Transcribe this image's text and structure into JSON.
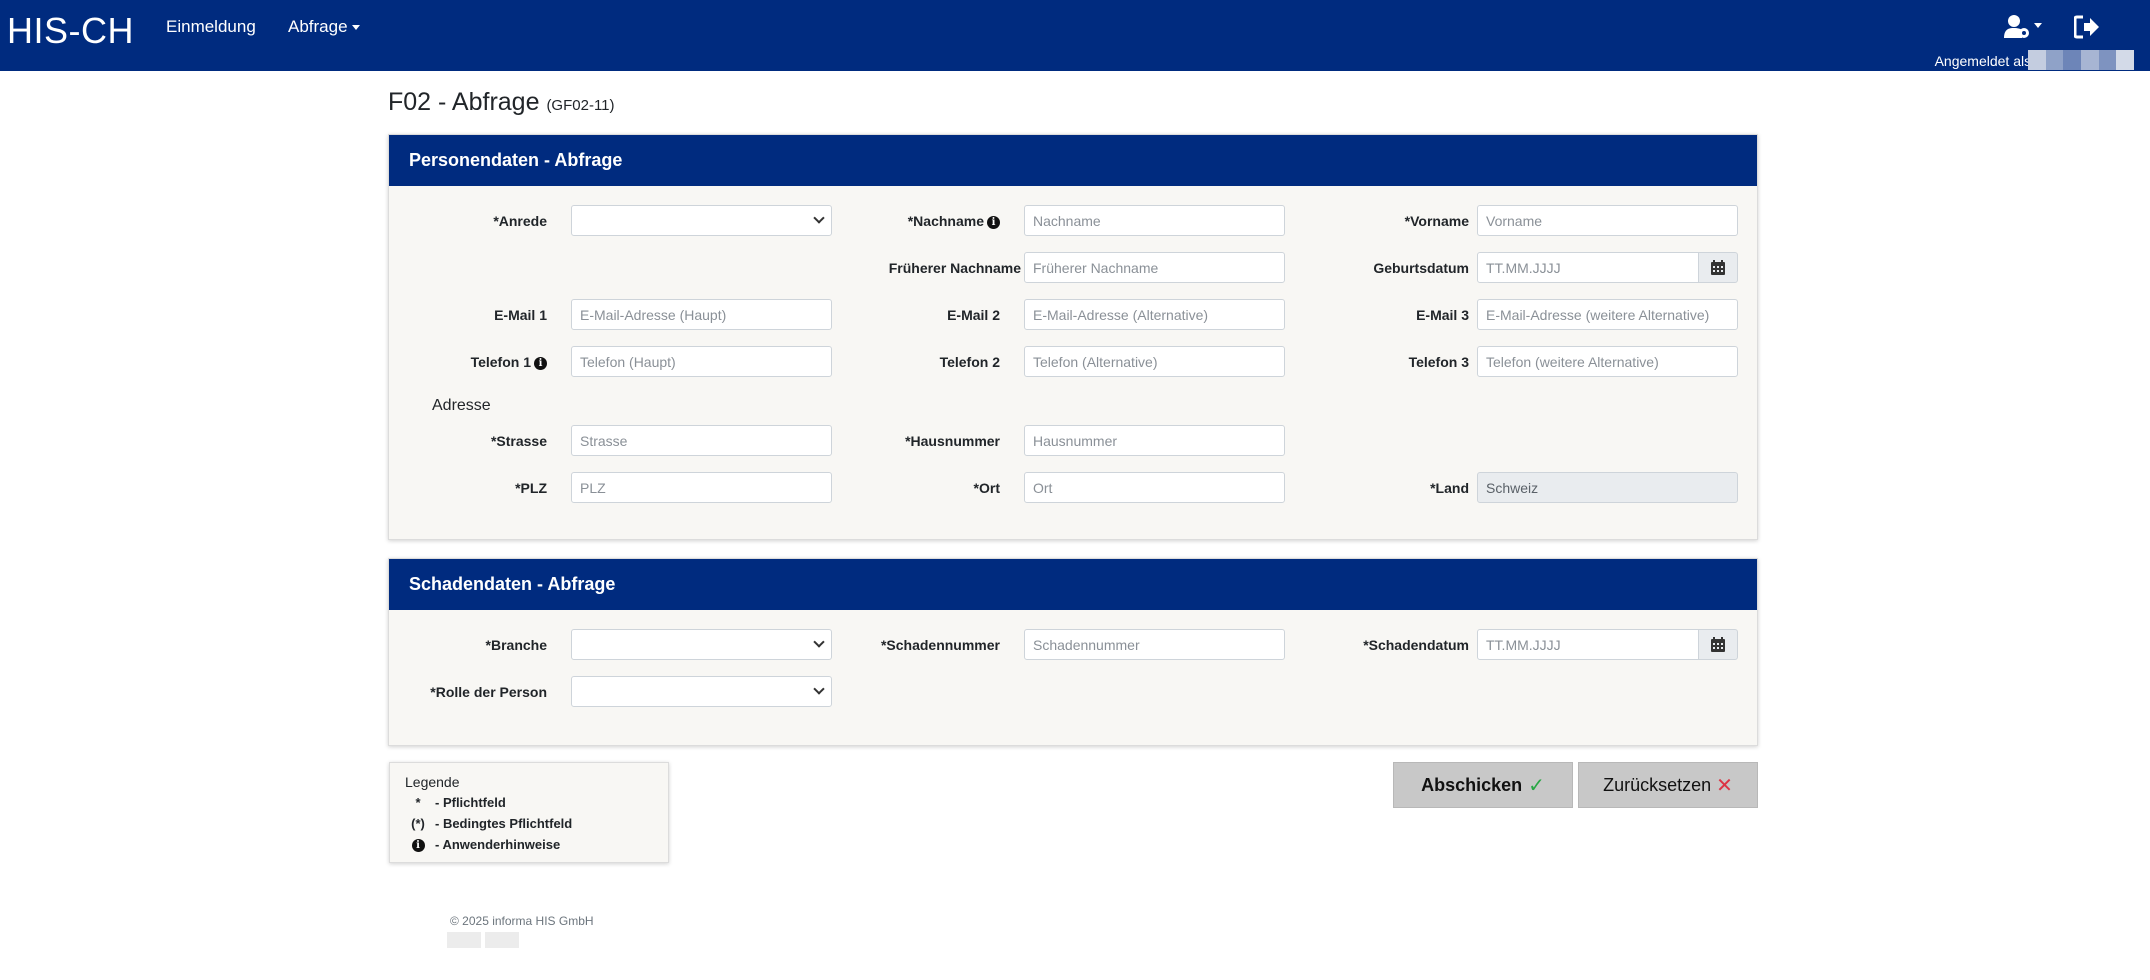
{
  "navbar": {
    "brand": "HIS-CH",
    "links": [
      {
        "label": "Einmeldung"
      },
      {
        "label": "Abfrage"
      }
    ],
    "logged_in_label": "Angemeldet als:"
  },
  "page": {
    "title": "F02 - Abfrage",
    "subtitle": "(GF02-11)"
  },
  "person_card": {
    "title": "Personendaten - Abfrage",
    "anrede_label": "*Anrede",
    "nachname_label": "*Nachname",
    "nachname_placeholder": "Nachname",
    "vorname_label": "*Vorname",
    "vorname_placeholder": "Vorname",
    "frueherer_label": "Früherer Nachname",
    "frueherer_placeholder": "Früherer Nachname",
    "geburtsdatum_label": "Geburtsdatum",
    "geburtsdatum_placeholder": "TT.MM.JJJJ",
    "email1_label": "E-Mail 1",
    "email1_placeholder": "E-Mail-Adresse (Haupt)",
    "email2_label": "E-Mail 2",
    "email2_placeholder": "E-Mail-Adresse (Alternative)",
    "email3_label": "E-Mail 3",
    "email3_placeholder": "E-Mail-Adresse (weitere Alternative)",
    "telefon1_label": "Telefon 1",
    "telefon1_placeholder": "Telefon (Haupt)",
    "telefon2_label": "Telefon 2",
    "telefon2_placeholder": "Telefon (Alternative)",
    "telefon3_label": "Telefon 3",
    "telefon3_placeholder": "Telefon (weitere Alternative)",
    "adresse_heading": "Adresse",
    "strasse_label": "*Strasse",
    "strasse_placeholder": "Strasse",
    "hausnummer_label": "*Hausnummer",
    "hausnummer_placeholder": "Hausnummer",
    "plz_label": "*PLZ",
    "plz_placeholder": "PLZ",
    "ort_label": "*Ort",
    "ort_placeholder": "Ort",
    "land_label": "*Land",
    "land_value": "Schweiz"
  },
  "schaden_card": {
    "title": "Schadendaten - Abfrage",
    "branche_label": "*Branche",
    "schadennummer_label": "*Schadennummer",
    "schadennummer_placeholder": "Schadennummer",
    "schadendatum_label": "*Schadendatum",
    "schadendatum_placeholder": "TT.MM.JJJJ",
    "rolle_label": "*Rolle der Person"
  },
  "buttons": {
    "submit_label": "Abschicken",
    "reset_label": "Zurücksetzen"
  },
  "legend": {
    "title": "Legende",
    "rows": [
      {
        "symbol": "*",
        "text": "- Pflichtfeld"
      },
      {
        "symbol": "(*)",
        "text": "- Bedingtes Pflichtfeld"
      },
      {
        "symbol": "i",
        "text": "- Anwenderhinweise"
      }
    ]
  },
  "footer": {
    "copyright": "© 2025 informa HIS GmbH"
  },
  "icons": {
    "user_settings": "user-cog-icon",
    "logout": "sign-out-icon",
    "calendar": "calendar-icon",
    "info": "info-circle-icon",
    "check": "check-icon",
    "cross": "times-icon"
  },
  "colors": {
    "brand_blue": "#002b7f",
    "card_bg": "#f8f7f4",
    "button_gray": "#c8c8c8",
    "check_green": "#28a745",
    "cross_red": "#dc3545"
  }
}
